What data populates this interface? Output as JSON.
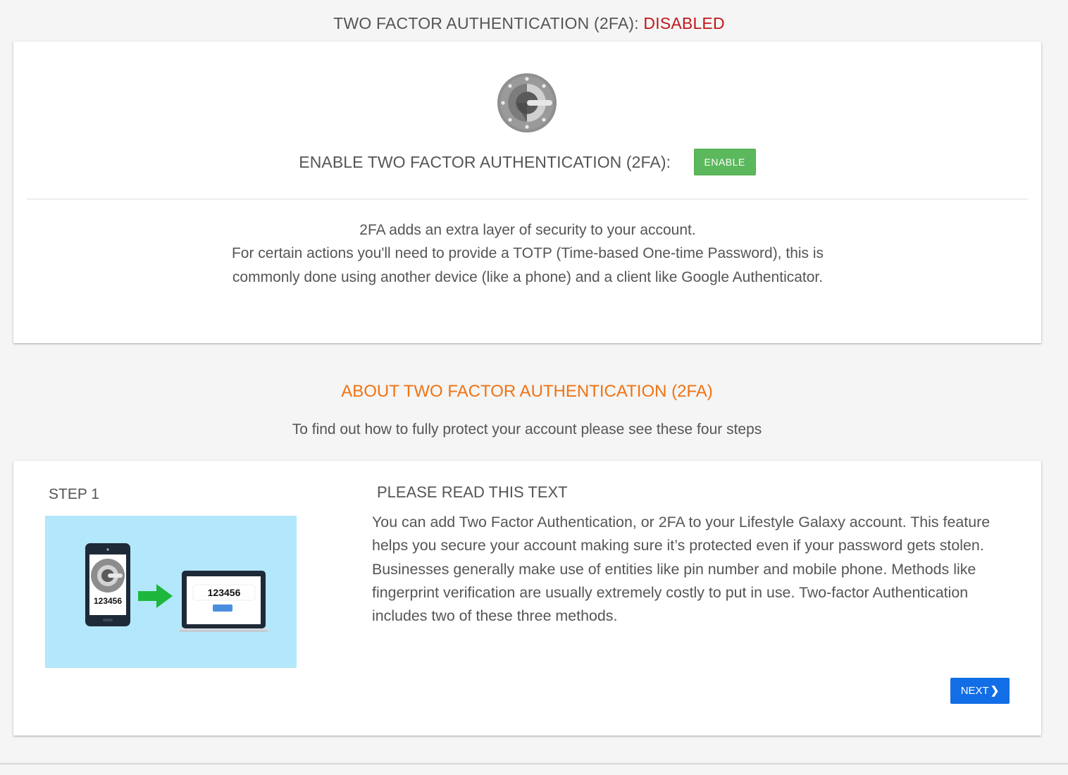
{
  "status": {
    "label": "TWO FACTOR AUTHENTICATION (2FA):",
    "value": "DISABLED",
    "value_color": "#c0181c"
  },
  "setup_card": {
    "logo_icon": "google-authenticator-icon",
    "enable_label": "ENABLE TWO FACTOR AUTHENTICATION (2FA):",
    "enable_button": "ENABLE",
    "enable_button_color": "#5cb85c",
    "description": [
      "2FA adds an extra layer of security to your account.",
      "For certain actions you'll need to provide a TOTP (Time-based One-time Password), this is commonly done using another device (like a phone) and a client like Google Authenticator."
    ]
  },
  "about": {
    "title": "ABOUT TWO FACTOR AUTHENTICATION (2FA)",
    "title_color": "#f07313",
    "subtitle": "To find out how to fully protect your account please see these four steps"
  },
  "step": {
    "label": "STEP 1",
    "illustration": {
      "phone_code": "123456",
      "laptop_code": "123456",
      "icons": [
        "phone-icon",
        "arrow-right-icon",
        "laptop-icon"
      ]
    },
    "title": "PLEASE READ THIS TEXT",
    "paragraphs": [
      "You can add Two Factor Authentication, or 2FA to your Lifestyle Galaxy account. This feature helps you secure your account making sure it’s protected even if your password gets stolen.",
      "Businesses generally make use of entities like pin number and mobile phone. Methods like fingerprint verification are usually extremely costly to put in use. Two-factor Authentication includes two of these three methods."
    ],
    "next_button": "NEXT",
    "next_button_color": "#126ee6"
  }
}
